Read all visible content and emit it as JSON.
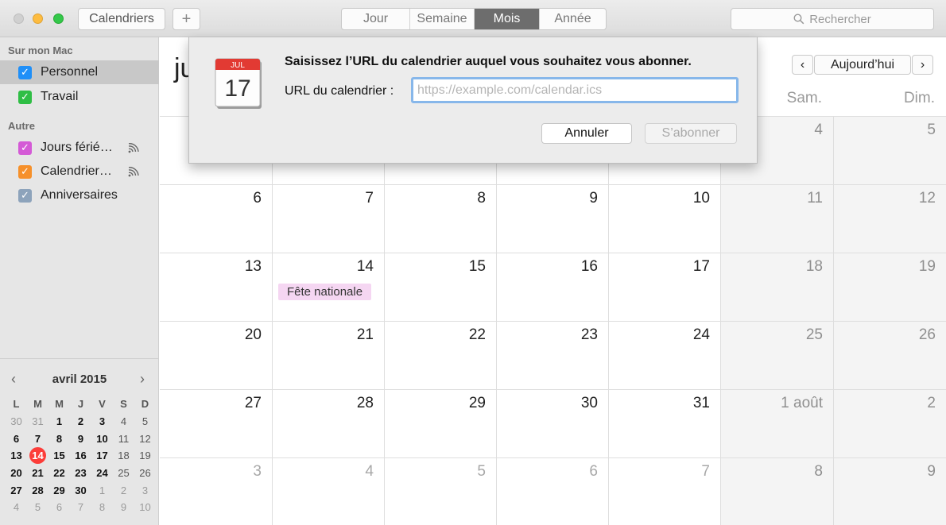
{
  "toolbar": {
    "calendars_label": "Calendriers",
    "add_label": "+",
    "views": [
      "Jour",
      "Semaine",
      "Mois",
      "Année"
    ],
    "active_view": "Mois",
    "search_placeholder": "Rechercher"
  },
  "sidebar": {
    "section_mac": "Sur mon Mac",
    "section_other": "Autre",
    "items": [
      {
        "label": "Personnel",
        "color": "#1f8ff8",
        "checked": true,
        "selected": true,
        "shared": false
      },
      {
        "label": "Travail",
        "color": "#2fbe45",
        "checked": true,
        "selected": false,
        "shared": false
      },
      {
        "label": "Jours férié…",
        "color": "#d45ad6",
        "checked": true,
        "selected": false,
        "shared": true
      },
      {
        "label": "Calendrier…",
        "color": "#f6902a",
        "checked": true,
        "selected": false,
        "shared": true
      },
      {
        "label": "Anniversaires",
        "color": "#8da3bb",
        "checked": true,
        "selected": false,
        "shared": false
      }
    ]
  },
  "mini_calendar": {
    "title": "avril 2015",
    "prev_icon": "chevron-left-icon",
    "next_icon": "chevron-right-icon",
    "weekdays": [
      "L",
      "M",
      "M",
      "J",
      "V",
      "S",
      "D"
    ],
    "weeks": [
      [
        "30",
        "31",
        "1",
        "2",
        "3",
        "4",
        "5"
      ],
      [
        "6",
        "7",
        "8",
        "9",
        "10",
        "11",
        "12"
      ],
      [
        "13",
        "14",
        "15",
        "16",
        "17",
        "18",
        "19"
      ],
      [
        "20",
        "21",
        "22",
        "23",
        "24",
        "25",
        "26"
      ],
      [
        "27",
        "28",
        "29",
        "30",
        "1",
        "2",
        "3"
      ],
      [
        "4",
        "5",
        "6",
        "7",
        "8",
        "9",
        "10"
      ]
    ],
    "today": "14"
  },
  "main": {
    "month_title": "ju",
    "today_label": "Aujourd’hui",
    "prev_label": "‹",
    "next_label": "›",
    "weekday_headers": [
      "Sam.",
      "Dim."
    ],
    "weeks": [
      [
        "",
        "",
        "",
        "",
        "",
        "4",
        "5"
      ],
      [
        "6",
        "7",
        "8",
        "9",
        "10",
        "11",
        "12"
      ],
      [
        "13",
        "14",
        "15",
        "16",
        "17",
        "18",
        "19"
      ],
      [
        "20",
        "21",
        "22",
        "23",
        "24",
        "25",
        "26"
      ],
      [
        "27",
        "28",
        "29",
        "30",
        "31",
        "1 août",
        "2"
      ],
      [
        "3",
        "4",
        "5",
        "6",
        "7",
        "8",
        "9"
      ]
    ],
    "event": {
      "label": "Fête nationale",
      "color": "#f5d6f2"
    }
  },
  "dialog": {
    "icon_month": "JUL",
    "icon_day": "17",
    "title": "Saisissez l’URL du calendrier auquel vous souhaitez vous abonner.",
    "url_label": "URL du calendrier :",
    "url_value": "",
    "url_placeholder": "https://example.com/calendar.ics",
    "cancel_label": "Annuler",
    "subscribe_label": "S’abonner"
  }
}
